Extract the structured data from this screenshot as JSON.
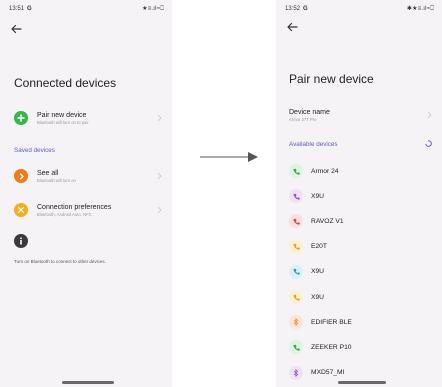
{
  "left": {
    "status": {
      "time": "13:51",
      "carrier_glyph": "G",
      "icons": "★≡.ıl≈⎕"
    },
    "title": "Connected devices",
    "pair_item": {
      "label": "Pair new device",
      "sub": "Bluetooth will turn on to pair",
      "color": "#35b54a"
    },
    "section_label": "Saved devices",
    "see_all": {
      "label": "See all",
      "sub": "Bluetooth will turn on",
      "color": "#f07a1c"
    },
    "connection_prefs": {
      "label": "Connection preferences",
      "sub": "Bluetooth, Android Auto, NFC",
      "color": "#f2b01e"
    },
    "footer": "Turn on Bluetooth to connect to other devices."
  },
  "right": {
    "status": {
      "time": "13:52",
      "carrier_glyph": "G",
      "icons": "✱★≡.ıl≈⎕"
    },
    "title": "Pair new device",
    "device_name": {
      "label": "Device name",
      "value": "Armor 27T Pro"
    },
    "section_label": "Available devices",
    "devices": [
      {
        "name": "Armor 24",
        "icon": "phone-icon",
        "color": "#2fa84f",
        "bg": "#dff2e3"
      },
      {
        "name": "X9U",
        "icon": "phone-icon",
        "color": "#9b4fd0",
        "bg": "#efe2f7"
      },
      {
        "name": "RAVOZ V1",
        "icon": "phone-icon",
        "color": "#d94848",
        "bg": "#f9e0e0"
      },
      {
        "name": "E20T",
        "icon": "phone-icon",
        "color": "#e6a21a",
        "bg": "#fbefd4"
      },
      {
        "name": "X9U",
        "icon": "phone-icon",
        "color": "#2aa0b8",
        "bg": "#dcf0f4"
      },
      {
        "name": "X9U",
        "icon": "phone-icon",
        "color": "#e6a21a",
        "bg": "#fbefd4"
      },
      {
        "name": "EDIFIER BLE",
        "icon": "bluetooth-icon",
        "color": "#e88a3a",
        "bg": "#fbe6d5"
      },
      {
        "name": "ZEEKER P10",
        "icon": "phone-icon",
        "color": "#2fa84f",
        "bg": "#dff2e3"
      },
      {
        "name": "MXD57_MI",
        "icon": "bluetooth-icon",
        "color": "#9b4fd0",
        "bg": "#efe2f7"
      }
    ]
  },
  "colors": {
    "accent": "#5c5bd2",
    "background": "#f5f3f6",
    "arrow": "#555555"
  }
}
